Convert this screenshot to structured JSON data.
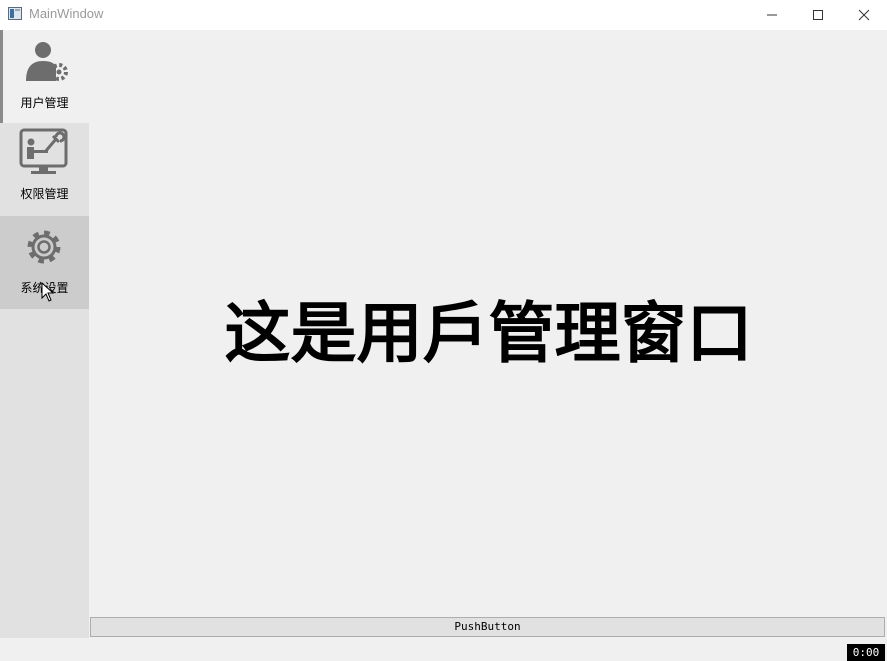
{
  "window": {
    "title": "MainWindow",
    "controls": {
      "minimize": "minimize-icon",
      "maximize": "maximize-icon",
      "close": "close-icon"
    }
  },
  "sidebar": {
    "items": [
      {
        "label": "用户管理",
        "icon": "user-settings-icon",
        "state": "selected"
      },
      {
        "label": "权限管理",
        "icon": "monitor-wrench-icon",
        "state": "normal"
      },
      {
        "label": "系统设置",
        "icon": "gear-icon",
        "state": "hover"
      }
    ]
  },
  "main": {
    "heading": "这是用戶管理窗口",
    "push_button": "PushButton"
  },
  "overlay": {
    "timer": "0:00"
  },
  "colors": {
    "sidebar_bg": "#e1e1e1",
    "selected_bg": "#f0f0f0",
    "hover_bg": "#cccccc",
    "icon_gray": "#6d6d6d"
  }
}
